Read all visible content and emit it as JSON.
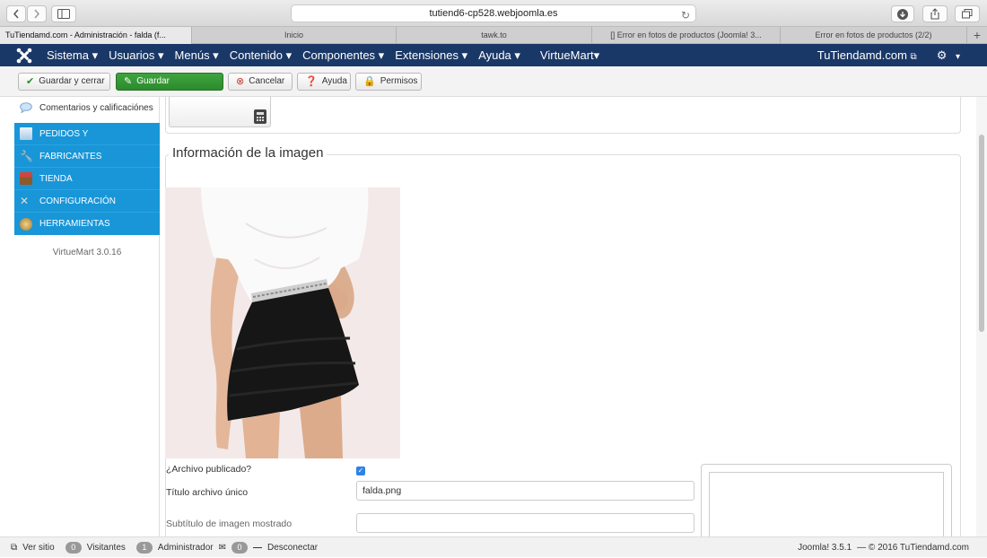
{
  "browser": {
    "url": "tutiend6-cp528.webjoomla.es",
    "tabs": [
      "TuTiendamd.com - Administración - falda (f...",
      "Inicio",
      "tawk.to",
      "[] Error en fotos de productos (Joomla! 3...",
      "Error en fotos de productos (2/2)"
    ]
  },
  "navbar": {
    "items": [
      "Sistema ▾",
      "Usuarios ▾",
      "Menús ▾",
      "Contenido ▾",
      "Componentes ▾",
      "Extensiones ▾",
      "Ayuda ▾",
      "VirtueMart▾"
    ],
    "site_link": "TuTiendamd.com",
    "gear_caret": "▾"
  },
  "toolbar": {
    "save_close": "Guardar y cerrar",
    "save": "Guardar",
    "cancel": "Cancelar",
    "help": "Ayuda",
    "permissions": "Permisos"
  },
  "sidebar": {
    "comments": "Comentarios y calificaciónes",
    "items": [
      "PEDIDOS Y",
      "FABRICANTES",
      "TIENDA",
      "CONFIGURACIÓN",
      "HERRAMIENTAS"
    ],
    "version": "VirtueMart 3.0.16"
  },
  "main": {
    "legend": "Información de la imagen",
    "published_label": "¿Archivo publicado?",
    "title_label": "Título archivo único",
    "title_value": "falda.png",
    "subtitle_label": "Subtítulo de imagen mostrado",
    "subtitle_value": ""
  },
  "status": {
    "view_site": "Ver sitio",
    "visitors_count": "0",
    "visitors_label": "Visitantes",
    "admins_count": "1",
    "admins_label": "Administrador",
    "messages_count": "0",
    "logout": "Desconectar",
    "version": "Joomla! 3.5.1",
    "copyright": "— © 2016 TuTiendamd.com"
  },
  "colors": {
    "navbar": "#1a3867",
    "sidebar_accent": "#1896d8",
    "save_green": "#2d8a2d"
  }
}
